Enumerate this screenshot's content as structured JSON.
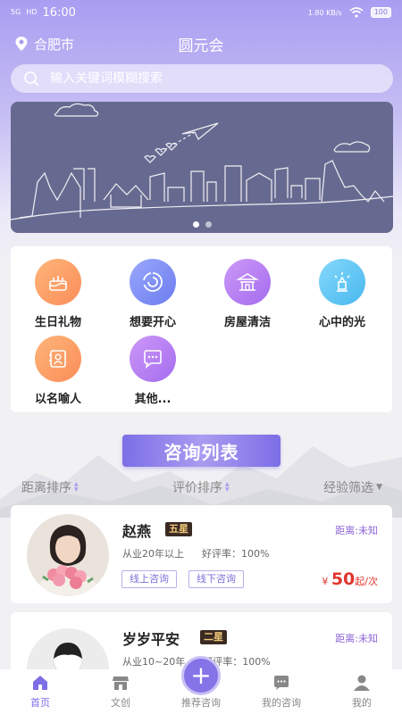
{
  "status_bar": {
    "signal": "5G",
    "hd": "HD",
    "time": "16:00",
    "net_speed": "1.80 KB/s",
    "battery": "100"
  },
  "header": {
    "city": "合肥市",
    "title": "圆元会"
  },
  "search": {
    "placeholder": "输入关键词模糊搜索"
  },
  "banner": {
    "dots": 2,
    "active_dot": 0
  },
  "categories": [
    {
      "label": "生日礼物",
      "icon": "cake-icon",
      "color": "#fb9a63"
    },
    {
      "label": "想要开心",
      "icon": "swirl-icon",
      "color": "#7a8cf6"
    },
    {
      "label": "房屋清洁",
      "icon": "pavilion-icon",
      "color": "#b178f2"
    },
    {
      "label": "心中的光",
      "icon": "light-icon",
      "color": "#5cc6f4"
    },
    {
      "label": "以名喻人",
      "icon": "contact-card-icon",
      "color": "#fb9a63"
    },
    {
      "label": "其他...",
      "icon": "chat-bubble-icon",
      "color": "#b178f2"
    }
  ],
  "list": {
    "title": "咨询列表",
    "sort": {
      "distance": "距离排序",
      "rating": "评价排序",
      "experience": "经验筛选"
    }
  },
  "consultants": [
    {
      "name": "赵燕",
      "level": "五星",
      "experience": "从业20年以上",
      "rating": "好评率：100%",
      "distance": "距离:未知",
      "tags": [
        "线上咨询",
        "线下咨询"
      ],
      "price_symbol": "¥",
      "price": "50",
      "price_unit": "起/次"
    },
    {
      "name": "岁岁平安",
      "level": "二星",
      "experience": "从业10~20年",
      "rating": "好评率：100%",
      "distance": "距离:未知"
    }
  ],
  "tabbar": {
    "home": "首页",
    "culture": "文创",
    "recommend": "推荐咨询",
    "my_consult": "我的咨询",
    "mine": "我的",
    "fab": "+"
  },
  "colors": {
    "accent": "#7c6ee6",
    "price": "#e0362e",
    "distance": "#8e64d8"
  }
}
